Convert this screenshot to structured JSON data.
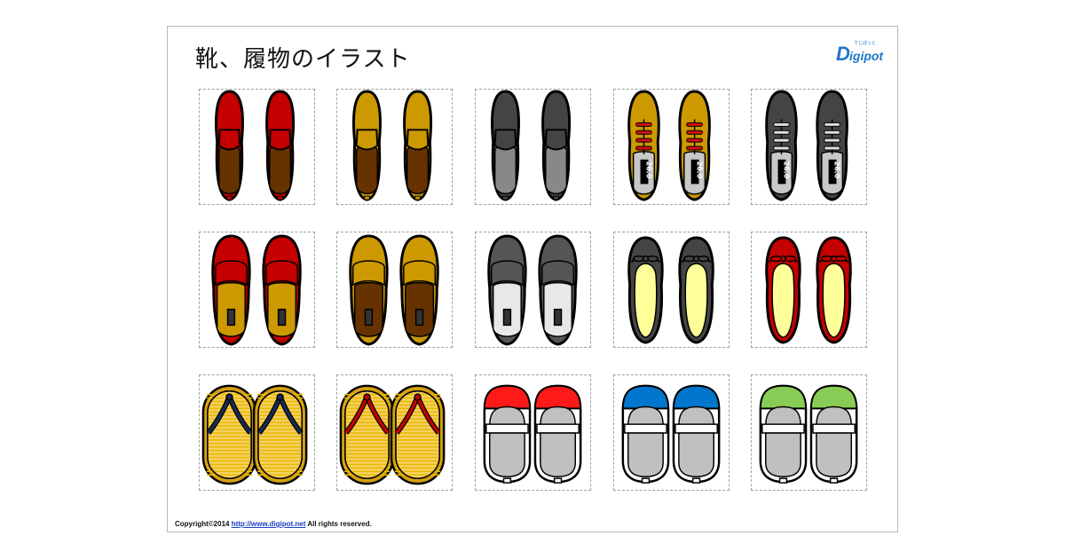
{
  "title": "靴、履物のイラスト",
  "logo": {
    "text": "Digipot",
    "small_text": "でじぽっと",
    "color": "#1f77c8"
  },
  "footer": {
    "prefix": "Copyright©2014",
    "link": "http://www.digipot.net",
    "suffix": "All rights reserved."
  },
  "colors": {
    "red": "#c40000",
    "gold": "#cc9900",
    "darkgray": "#444444",
    "brown": "#663300",
    "lightgray": "#c8c8c8",
    "cream": "#ffff99",
    "blue": "#0077cc",
    "green": "#88cc55",
    "navy": "#1a2a55"
  },
  "shoes": [
    {
      "type": "loafer",
      "upper": "#c40000",
      "sole": "#663300"
    },
    {
      "type": "loafer",
      "upper": "#cc9900",
      "sole": "#663300"
    },
    {
      "type": "loafer",
      "upper": "#444444",
      "sole": "#888888"
    },
    {
      "type": "sneaker",
      "upper": "#cc9900",
      "lace": "#d01010",
      "size": "26.0"
    },
    {
      "type": "sneaker",
      "upper": "#444444",
      "lace": "#dddddd",
      "size": "26.0"
    },
    {
      "type": "slipper",
      "upper": "#c40000",
      "sole": "#cc9900"
    },
    {
      "type": "slipper",
      "upper": "#cc9900",
      "sole": "#663300"
    },
    {
      "type": "slipper",
      "upper": "#555555",
      "sole": "#e8e8e8"
    },
    {
      "type": "flat",
      "upper": "#444444",
      "sole": "#ffff99"
    },
    {
      "type": "flat",
      "upper": "#c40000",
      "sole": "#ffff99"
    },
    {
      "type": "sandal",
      "strap": "#1a2a55"
    },
    {
      "type": "sandal",
      "strap": "#c40000"
    },
    {
      "type": "uwabaki",
      "toe": "#ff1a1a"
    },
    {
      "type": "uwabaki",
      "toe": "#0077cc"
    },
    {
      "type": "uwabaki",
      "toe": "#88cc55"
    }
  ]
}
